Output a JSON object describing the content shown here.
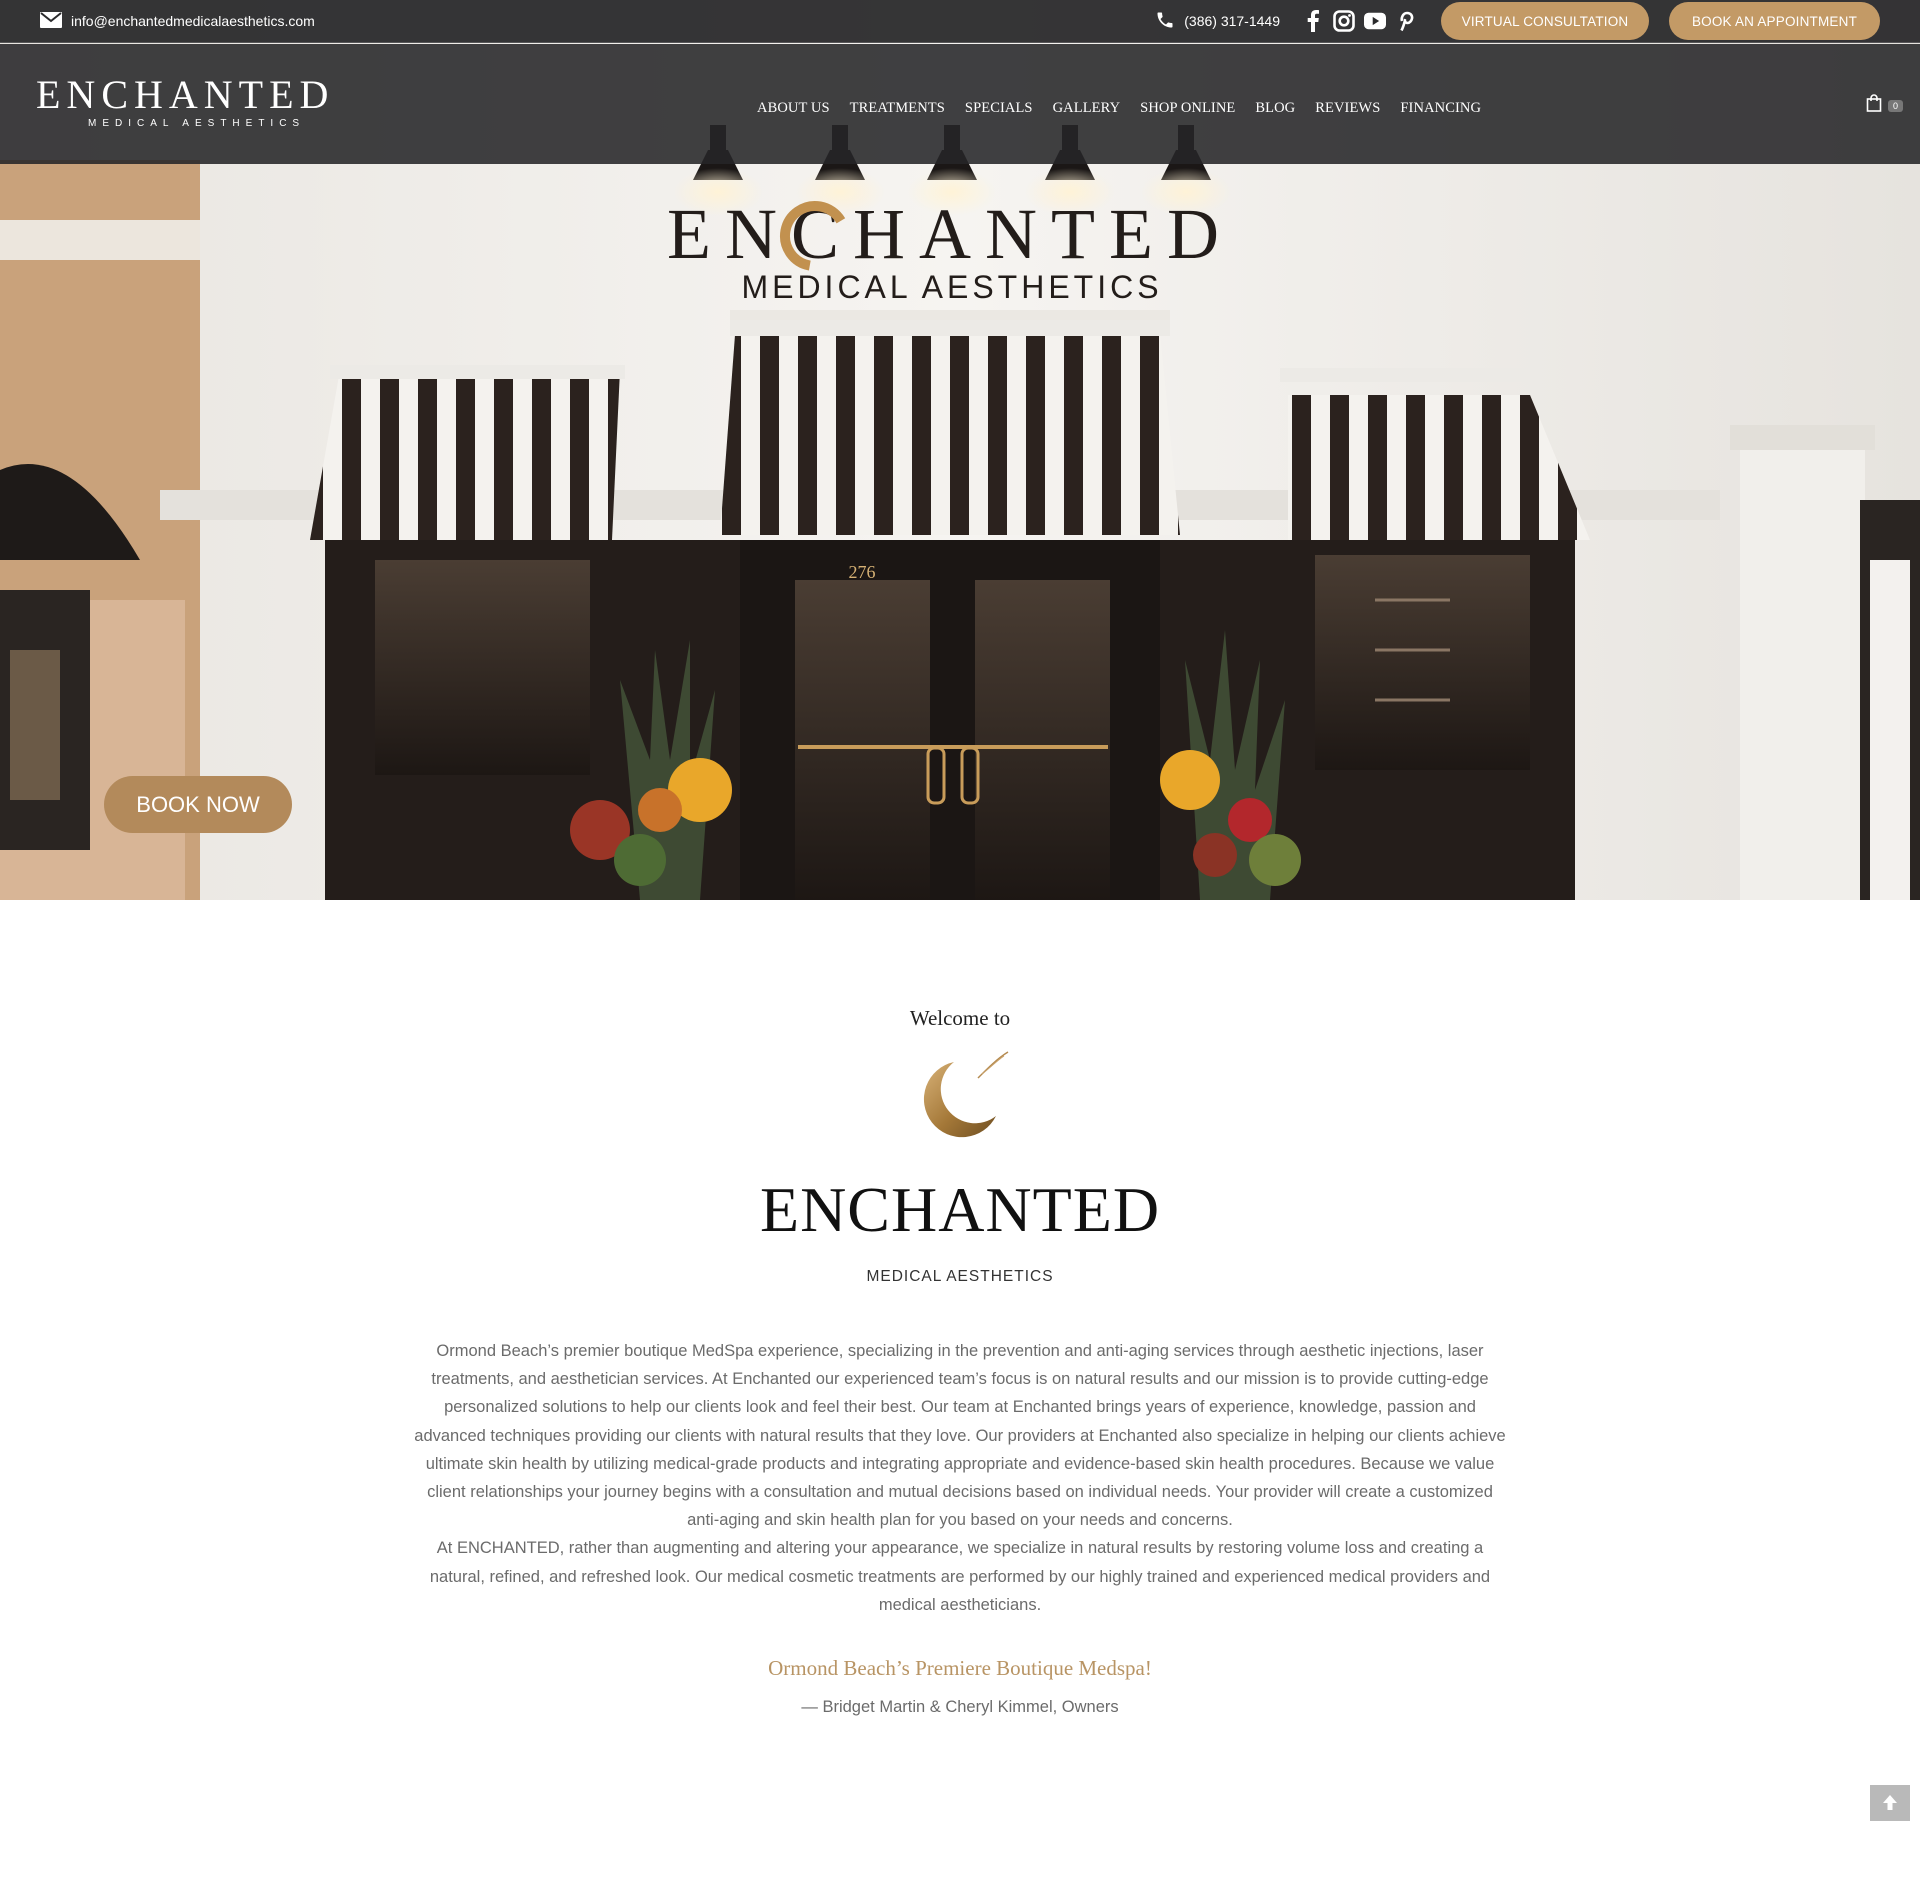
{
  "topbar": {
    "email": "info@enchantedmedicalaesthetics.com",
    "phone": "(386) 317-1449",
    "social_icons": [
      "facebook-icon",
      "instagram-icon",
      "youtube-icon",
      "pinterest-icon"
    ],
    "virtual_consultation_label": "VIRTUAL CONSULTATION",
    "book_appointment_label": "BOOK AN APPOINTMENT"
  },
  "logo": {
    "wordmark": "ENCHANTED",
    "subtitle": "MEDICAL AESTHETICS"
  },
  "nav": {
    "items": [
      "ABOUT US",
      "TREATMENTS",
      "SPECIALS",
      "GALLERY",
      "SHOP ONLINE",
      "BLOG",
      "REVIEWS",
      "FINANCING"
    ]
  },
  "cart": {
    "count": "0"
  },
  "hero": {
    "sign_title": "ENCHANTED",
    "sign_subtitle": "MEDICAL AESTHETICS",
    "door_number": "276",
    "book_now_label": "BOOK NOW"
  },
  "welcome": {
    "pre_title": "Welcome to",
    "brand": "ENCHANTED",
    "brand_sub": "MEDICAL AESTHETICS",
    "paragraph_1": "Ormond Beach’s premier boutique MedSpa experience, specializing in the prevention and anti-aging services through aesthetic injections, laser treatments, and aesthetician services. At Enchanted our experienced team’s focus is on natural results and our mission is to provide cutting-edge personalized solutions to help our clients look and feel their best. Our team at Enchanted brings years of experience, knowledge, passion and advanced techniques providing our clients with natural results that they love. Our providers at Enchanted also specialize in helping our clients achieve ultimate skin health by utilizing medical-grade products and integrating appropriate and evidence-based skin health procedures. Because we value client relationships your journey begins with a consultation and mutual decisions based on individual needs. Your provider will create a customized anti-aging and skin health plan for you based on your needs and concerns.",
    "paragraph_2": "At ENCHANTED, rather than augmenting and altering your appearance, we specialize in natural results by restoring volume loss and creating a natural, refined, and refreshed look. Our medical cosmetic treatments are performed by our highly trained and experienced medical providers and medical aestheticians.",
    "tagline": "Ormond Beach’s Premiere Boutique Medspa!",
    "owners": "— Bridget Martin & Cheryl Kimmel, Owners"
  },
  "colors": {
    "accent_gold": "#c39a66",
    "book_now": "#b38a5b",
    "tagline_gold": "#b89464",
    "header_dark": "#262628"
  }
}
